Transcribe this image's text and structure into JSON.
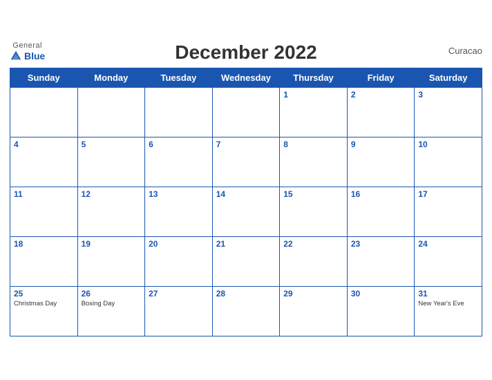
{
  "header": {
    "logo": {
      "general": "General",
      "blue": "Blue"
    },
    "title": "December 2022",
    "country": "Curacao"
  },
  "days_of_week": [
    "Sunday",
    "Monday",
    "Tuesday",
    "Wednesday",
    "Thursday",
    "Friday",
    "Saturday"
  ],
  "weeks": [
    [
      {
        "date": "",
        "holiday": ""
      },
      {
        "date": "",
        "holiday": ""
      },
      {
        "date": "",
        "holiday": ""
      },
      {
        "date": "",
        "holiday": ""
      },
      {
        "date": "1",
        "holiday": ""
      },
      {
        "date": "2",
        "holiday": ""
      },
      {
        "date": "3",
        "holiday": ""
      }
    ],
    [
      {
        "date": "4",
        "holiday": ""
      },
      {
        "date": "5",
        "holiday": ""
      },
      {
        "date": "6",
        "holiday": ""
      },
      {
        "date": "7",
        "holiday": ""
      },
      {
        "date": "8",
        "holiday": ""
      },
      {
        "date": "9",
        "holiday": ""
      },
      {
        "date": "10",
        "holiday": ""
      }
    ],
    [
      {
        "date": "11",
        "holiday": ""
      },
      {
        "date": "12",
        "holiday": ""
      },
      {
        "date": "13",
        "holiday": ""
      },
      {
        "date": "14",
        "holiday": ""
      },
      {
        "date": "15",
        "holiday": ""
      },
      {
        "date": "16",
        "holiday": ""
      },
      {
        "date": "17",
        "holiday": ""
      }
    ],
    [
      {
        "date": "18",
        "holiday": ""
      },
      {
        "date": "19",
        "holiday": ""
      },
      {
        "date": "20",
        "holiday": ""
      },
      {
        "date": "21",
        "holiday": ""
      },
      {
        "date": "22",
        "holiday": ""
      },
      {
        "date": "23",
        "holiday": ""
      },
      {
        "date": "24",
        "holiday": ""
      }
    ],
    [
      {
        "date": "25",
        "holiday": "Christmas Day"
      },
      {
        "date": "26",
        "holiday": "Boxing Day"
      },
      {
        "date": "27",
        "holiday": ""
      },
      {
        "date": "28",
        "holiday": ""
      },
      {
        "date": "29",
        "holiday": ""
      },
      {
        "date": "30",
        "holiday": ""
      },
      {
        "date": "31",
        "holiday": "New Year's Eve"
      }
    ]
  ]
}
